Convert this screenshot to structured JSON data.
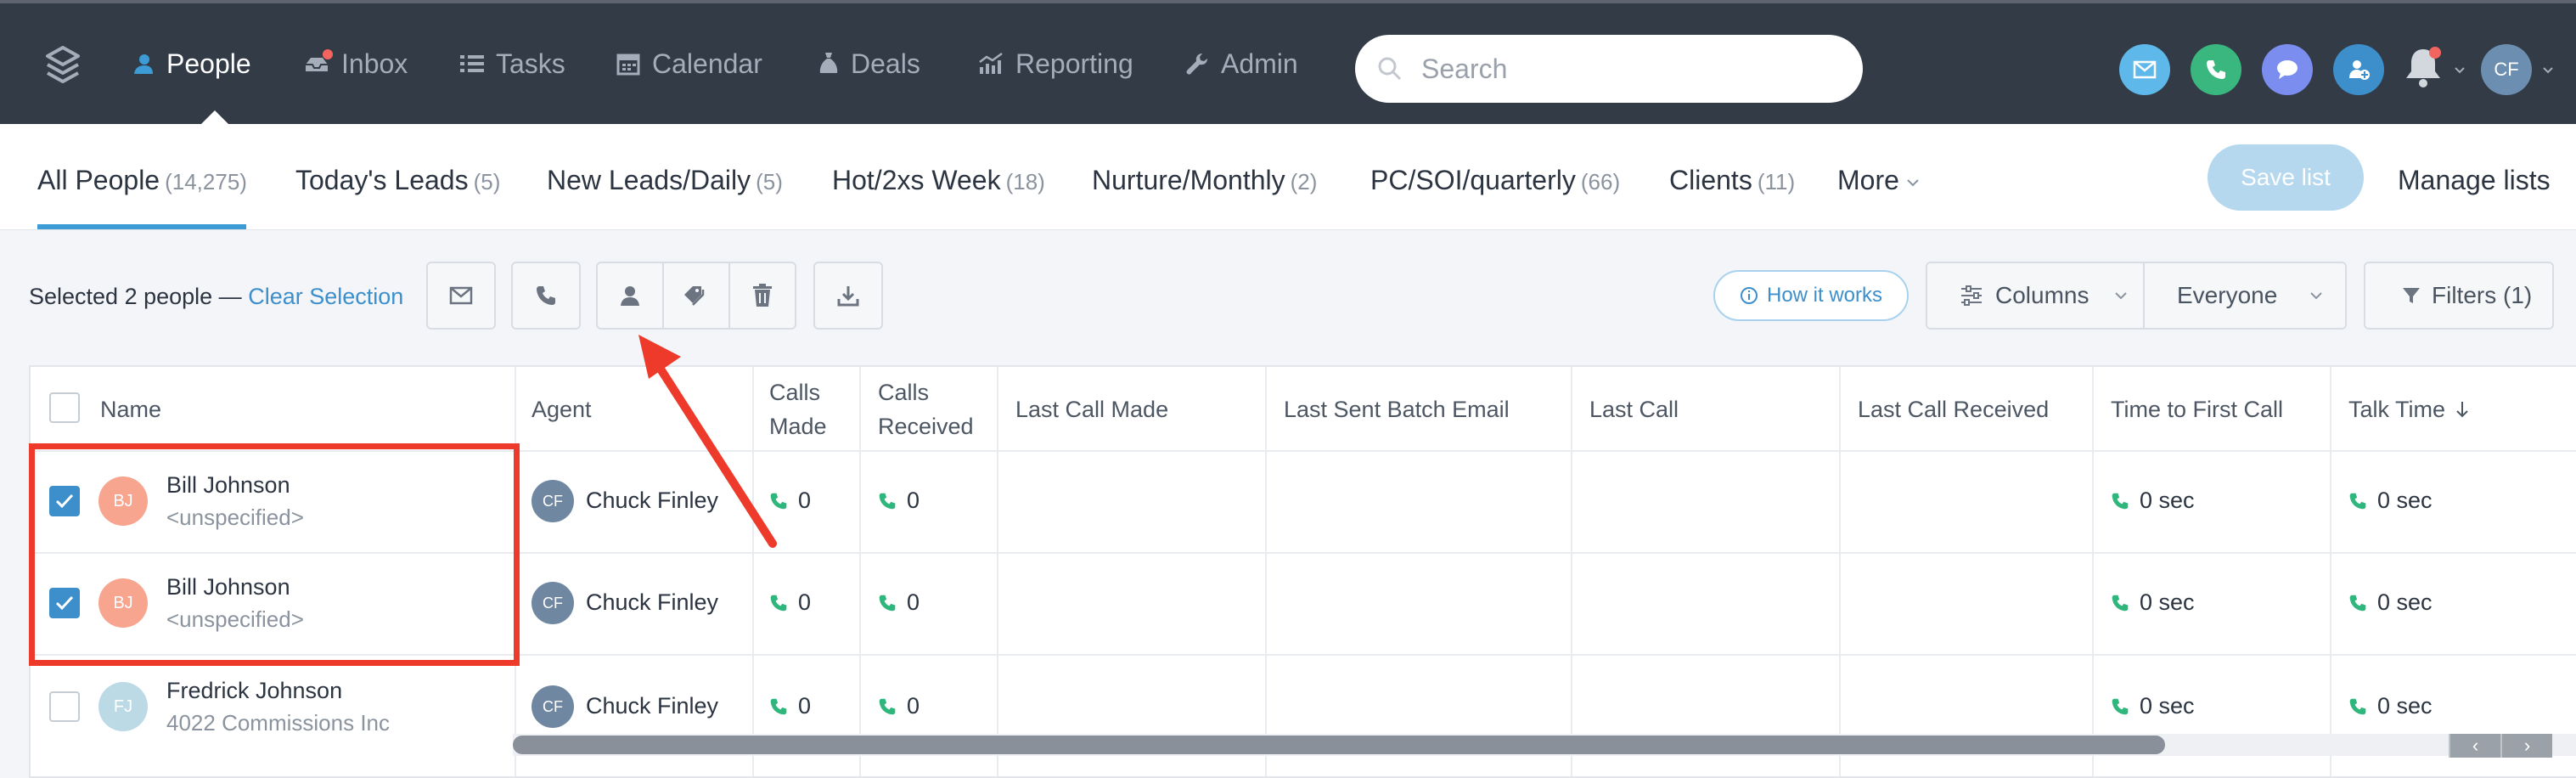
{
  "nav": {
    "items": [
      {
        "label": "People"
      },
      {
        "label": "Inbox"
      },
      {
        "label": "Tasks"
      },
      {
        "label": "Calendar"
      },
      {
        "label": "Deals"
      },
      {
        "label": "Reporting"
      },
      {
        "label": "Admin"
      }
    ],
    "active": "People",
    "search_placeholder": "Search",
    "user_initials": "CF"
  },
  "lists": {
    "tabs": [
      {
        "label": "All People",
        "count": "(14,275)"
      },
      {
        "label": "Today's Leads",
        "count": "(5)"
      },
      {
        "label": "New Leads/Daily",
        "count": "(5)"
      },
      {
        "label": "Hot/2xs Week",
        "count": "(18)"
      },
      {
        "label": "Nurture/Monthly",
        "count": "(2)"
      },
      {
        "label": "PC/SOI/quarterly",
        "count": "(66)"
      },
      {
        "label": "Clients",
        "count": "(11)"
      },
      {
        "label": "More",
        "count": ""
      }
    ],
    "save_label": "Save list",
    "manage_label": "Manage lists"
  },
  "toolbar": {
    "selected_text": "Selected 2 people —",
    "clear_label": "Clear Selection",
    "how_label": "How it works",
    "columns_label": "Columns",
    "everyone_label": "Everyone",
    "filters_label": "Filters (1)"
  },
  "table": {
    "headers": {
      "name": "Name",
      "agent": "Agent",
      "calls_made_1": "Calls",
      "calls_made_2": "Made",
      "calls_received_1": "Calls",
      "calls_received_2": "Received",
      "last_call_made": "Last Call Made",
      "last_sent_batch_email": "Last Sent Batch Email",
      "last_call": "Last Call",
      "last_call_received": "Last Call Received",
      "time_to_first_call": "Time to First Call",
      "talk_time": "Talk Time"
    },
    "rows": [
      {
        "initials": "BJ",
        "name": "Bill Johnson",
        "sub": "<unspecified>",
        "agent_initials": "CF",
        "agent": "Chuck Finley",
        "calls_made": "0",
        "calls_received": "0",
        "time_to_first_call": "0 sec",
        "talk_time": "0 sec",
        "checked": true
      },
      {
        "initials": "BJ",
        "name": "Bill Johnson",
        "sub": "<unspecified>",
        "agent_initials": "CF",
        "agent": "Chuck Finley",
        "calls_made": "0",
        "calls_received": "0",
        "time_to_first_call": "0 sec",
        "talk_time": "0 sec",
        "checked": true
      },
      {
        "initials": "FJ",
        "name": "Fredrick Johnson",
        "sub": "4022 Commissions Inc",
        "agent_initials": "CF",
        "agent": "Chuck Finley",
        "calls_made": "0",
        "calls_received": "0",
        "time_to_first_call": "0 sec",
        "talk_time": "0 sec",
        "checked": false
      }
    ]
  },
  "colors": {
    "accent": "#3d8fcc",
    "topbar": "#323b46",
    "annotation": "#ee3a2b",
    "phone": "#2fb67c"
  }
}
